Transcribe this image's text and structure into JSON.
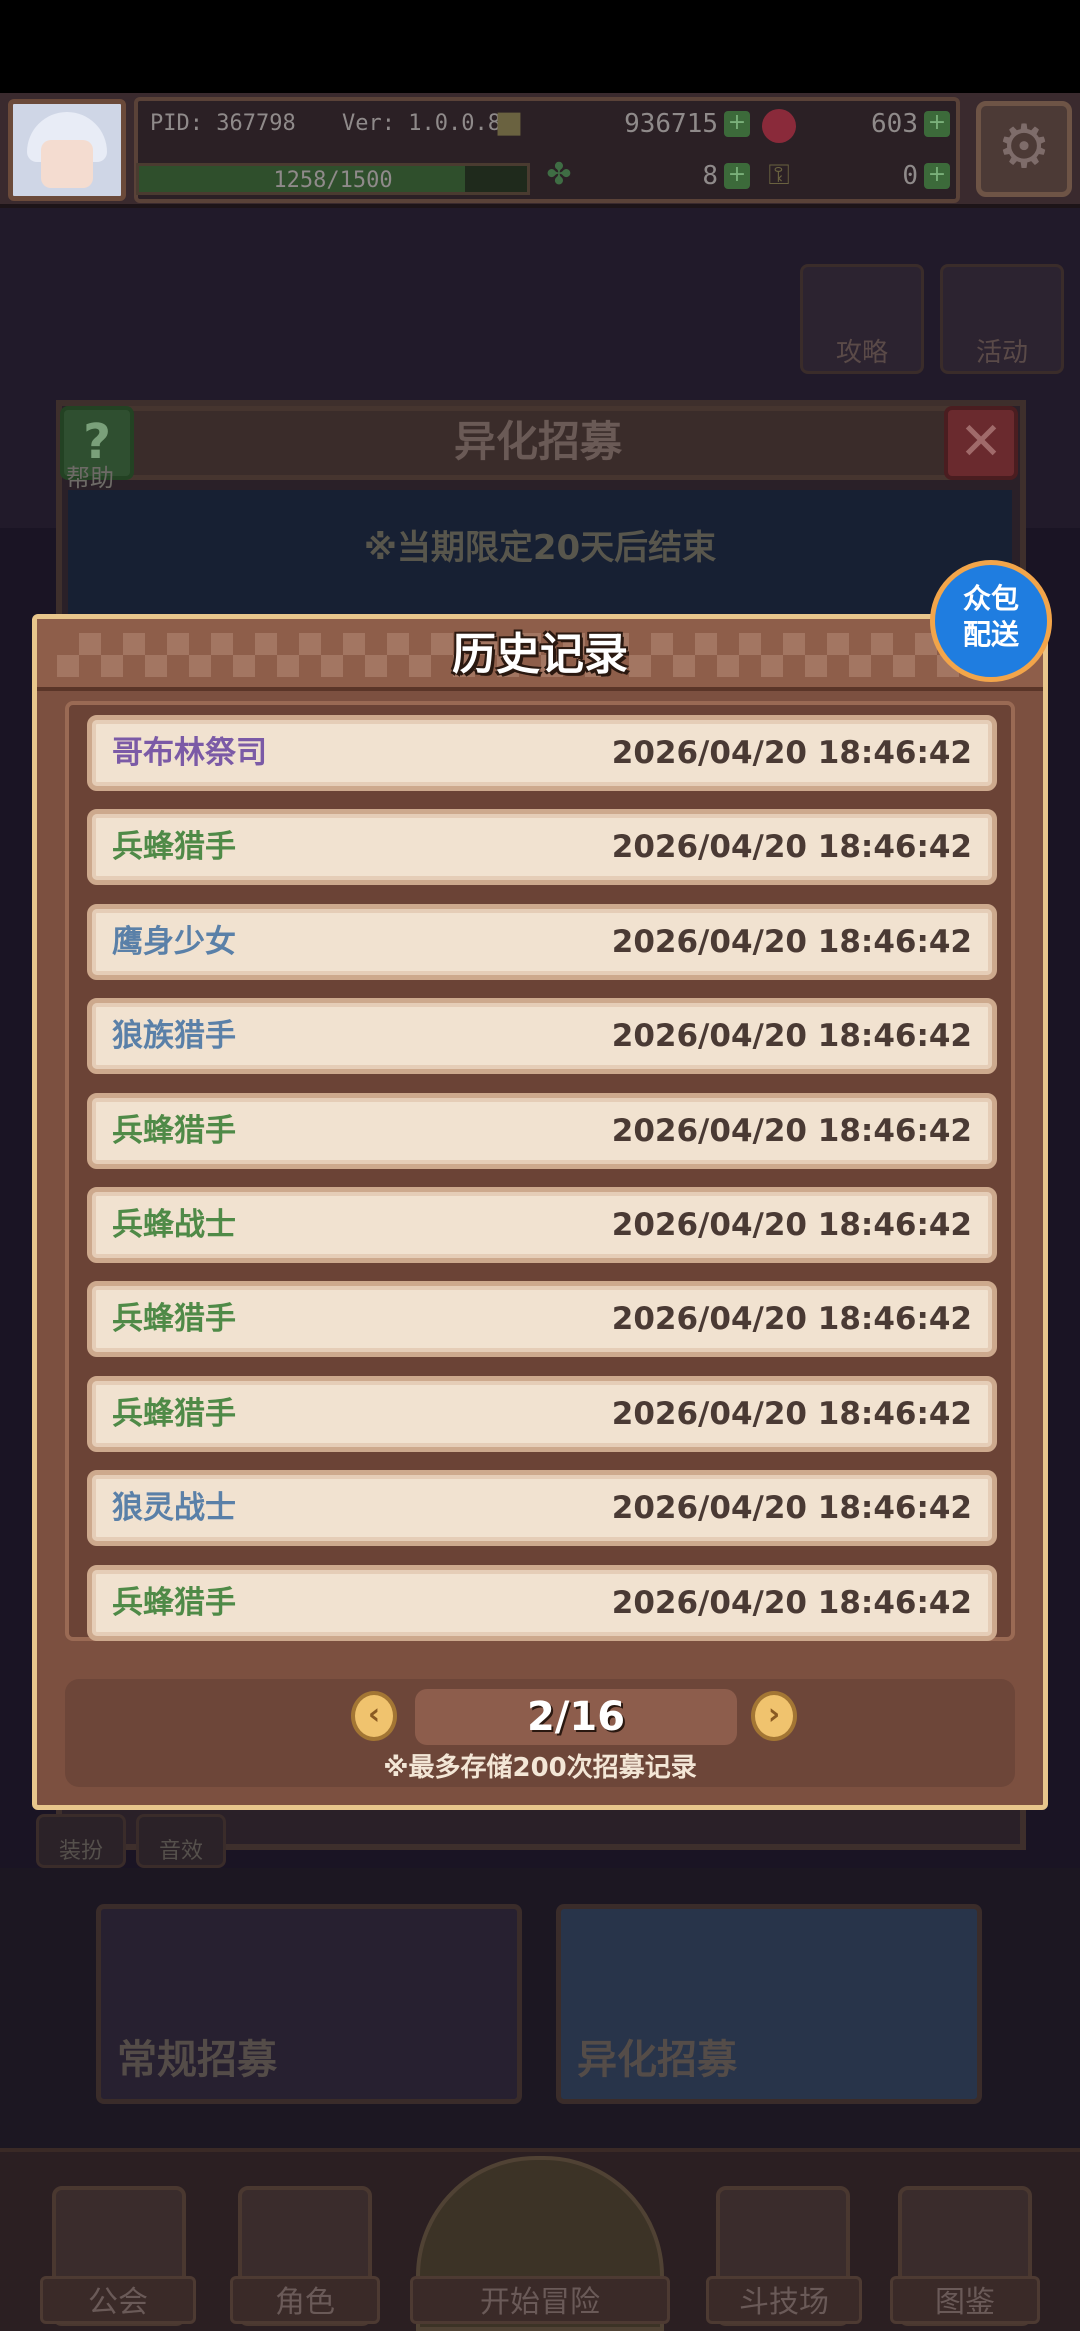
{
  "hud": {
    "pid": "PID: 367798",
    "version": "Ver: 1.0.0.8",
    "coins": "936715",
    "gems": "603",
    "energy": "1258/1500",
    "clovers": "8",
    "keys": "0"
  },
  "background": {
    "side_buttons": [
      "攻略",
      "活动"
    ],
    "recruit_title": "异化招募",
    "help_label": "帮助",
    "limit_notice": "※当期限定20天后结束",
    "under_buttons": [
      "装扮",
      "音效"
    ],
    "recruit_tabs": [
      "常规招募",
      "异化招募"
    ]
  },
  "delivery_badge": {
    "line1": "众包",
    "line2": "配送"
  },
  "history": {
    "title": "历史记录",
    "rows": [
      {
        "name": "哥布林祭司",
        "time": "2026/04/20 18:46:42",
        "color": "#7b5aa6"
      },
      {
        "name": "兵蜂猎手",
        "time": "2026/04/20 18:46:42",
        "color": "#4f8a47"
      },
      {
        "name": "鹰身少女",
        "time": "2026/04/20 18:46:42",
        "color": "#5a80a8"
      },
      {
        "name": "狼族猎手",
        "time": "2026/04/20 18:46:42",
        "color": "#5a80a8"
      },
      {
        "name": "兵蜂猎手",
        "time": "2026/04/20 18:46:42",
        "color": "#4f8a47"
      },
      {
        "name": "兵蜂战士",
        "time": "2026/04/20 18:46:42",
        "color": "#4f8a47"
      },
      {
        "name": "兵蜂猎手",
        "time": "2026/04/20 18:46:42",
        "color": "#4f8a47"
      },
      {
        "name": "兵蜂猎手",
        "time": "2026/04/20 18:46:42",
        "color": "#4f8a47"
      },
      {
        "name": "狼灵战士",
        "time": "2026/04/20 18:46:42",
        "color": "#5a80a8"
      },
      {
        "name": "兵蜂猎手",
        "time": "2026/04/20 18:46:42",
        "color": "#4f8a47"
      }
    ],
    "page": "2/16",
    "note": "※最多存储200次招募记录"
  },
  "nav": {
    "items": [
      "公会",
      "角色",
      "开始冒险",
      "斗技场",
      "图鉴"
    ]
  }
}
